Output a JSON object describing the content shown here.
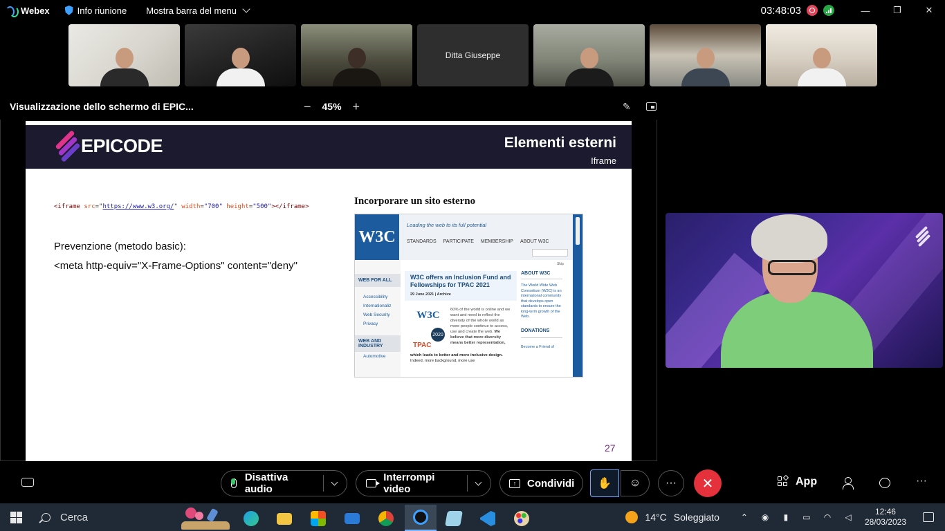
{
  "topbar": {
    "app_name": "Webex",
    "meeting_info": "Info riunione",
    "menu_bar": "Mostra barra del menu",
    "timer": "03:48:03",
    "window_controls": [
      "—",
      "❐",
      "✕"
    ]
  },
  "participants": [
    {
      "name": ""
    },
    {
      "name": ""
    },
    {
      "name": ""
    },
    {
      "name": "Ditta Giuseppe"
    },
    {
      "name": ""
    },
    {
      "name": ""
    },
    {
      "name": ""
    }
  ],
  "share": {
    "title": "Visualizzazione dello schermo di EPIC...",
    "zoom": "45%",
    "zoom_out": "−",
    "zoom_in": "+"
  },
  "slide": {
    "brand": "EPICODE",
    "title": "Elementi esterni",
    "subtitle": "Iframe",
    "code": {
      "open": "<iframe",
      "src_attr": "src",
      "src_val": "https://www.w3.org/",
      "width_attr": "width",
      "width_val": "\"700\"",
      "height_attr": "height",
      "height_val": "\"500\"",
      "close": "></iframe>"
    },
    "prevention_label": "Prevenzione (metodo basic):",
    "prevention_code": "<meta http-equiv=\"X-Frame-Options\" content=\"deny\"",
    "embed_title": "Incorporare un sito esterno",
    "page_number": "27"
  },
  "w3c": {
    "logo": "W3C",
    "tagline": "Leading the web to its full potential",
    "nav": [
      "STANDARDS",
      "PARTICIPATE",
      "MEMBERSHIP",
      "ABOUT W3C"
    ],
    "skip": "Skip",
    "left_section_1": "WEB FOR ALL",
    "left_links_1": [
      "Accessibility",
      "Internationaliz",
      "Web Security",
      "Privacy"
    ],
    "left_section_2": "WEB AND INDUSTRY",
    "left_links_2": [
      "Automotive"
    ],
    "headline": "W3C offers an Inclusion Fund and Fellowships for TPAC 2021",
    "date": "29 June 2021 | Archive",
    "badge_logo": "W3C",
    "badge_year": "2020",
    "badge_tpac": "TPAC",
    "body_1": "60% of the world is online and we want and need to reflect the diversity of the whole world as more people continue to access, use and create the web.",
    "body_1_bold": "We believe that more diversity means better representation,",
    "body_2_bold": "which leads to better and more inclusive design.",
    "body_2": "Indeed, more background, more use",
    "about_title": "ABOUT W3C",
    "about_text": "The World Wide Web Consortium (W3C) is an international community that develops open standards to ensure the long-term growth of the Web.",
    "donations": "DONATIONS",
    "friend": "Become a Friend of"
  },
  "controls": {
    "mute": "Disattiva audio",
    "video": "Interrompi video",
    "share": "Condividi",
    "hand_icon": "raise-hand-icon",
    "reactions_icon": "reactions-icon",
    "more": "···",
    "leave_icon": "✕",
    "apps": "App",
    "more2": "···",
    "colors": {
      "leave": "#e4313b",
      "mic_active": "#3ec46d"
    }
  },
  "taskbar": {
    "search": "Cerca",
    "weather_temp": "14°C",
    "weather_desc": "Soleggiato",
    "time": "12:46",
    "date": "28/03/2023"
  }
}
